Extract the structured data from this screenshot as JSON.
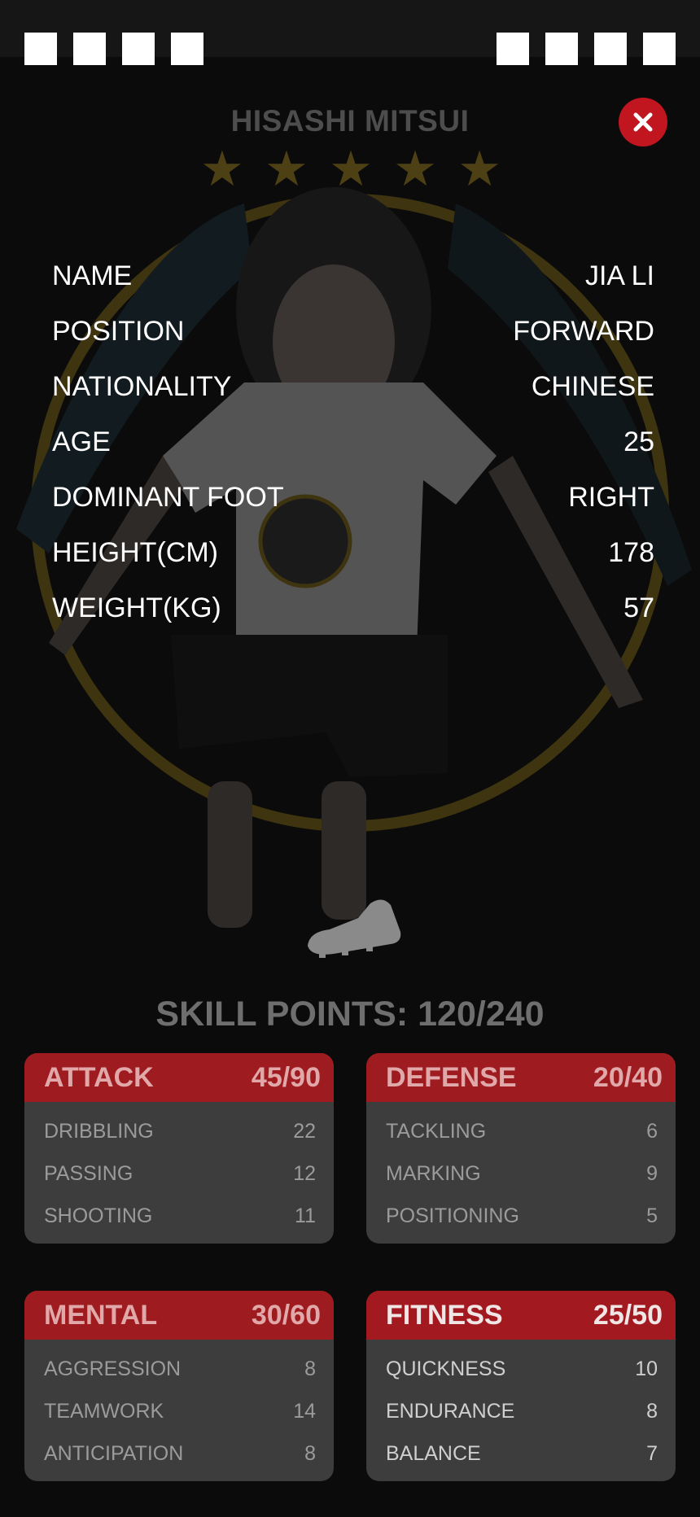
{
  "header": {
    "player_title": "HISASHI MITSUI",
    "star_rating": 5
  },
  "profile": [
    {
      "label": "NAME",
      "value": "JIA LI"
    },
    {
      "label": "POSITION",
      "value": "FORWARD"
    },
    {
      "label": "NATIONALITY",
      "value": "CHINESE"
    },
    {
      "label": "AGE",
      "value": "25"
    },
    {
      "label": "DOMINANT FOOT",
      "value": "RIGHT"
    },
    {
      "label": "HEIGHT(CM)",
      "value": "178"
    },
    {
      "label": "WEIGHT(KG)",
      "value": "57"
    }
  ],
  "skill_points": "SKILL POINTS: 120/240",
  "categories": [
    {
      "name": "ATTACK",
      "score": "45/90",
      "stats": [
        {
          "label": "DRIBBLING",
          "value": "22"
        },
        {
          "label": "PASSING",
          "value": "12"
        },
        {
          "label": "SHOOTING",
          "value": "11"
        }
      ]
    },
    {
      "name": "DEFENSE",
      "score": "20/40",
      "stats": [
        {
          "label": "TACKLING",
          "value": "6"
        },
        {
          "label": "MARKING",
          "value": "9"
        },
        {
          "label": "POSITIONING",
          "value": "5"
        }
      ]
    },
    {
      "name": "MENTAL",
      "score": "30/60",
      "stats": [
        {
          "label": "AGGRESSION",
          "value": "8"
        },
        {
          "label": "TEAMWORK",
          "value": "14"
        },
        {
          "label": "ANTICIPATION",
          "value": "8"
        }
      ]
    },
    {
      "name": "FITNESS",
      "score": "25/50",
      "stats": [
        {
          "label": "QUICKNESS",
          "value": "10"
        },
        {
          "label": "ENDURANCE",
          "value": "8"
        },
        {
          "label": "BALANCE",
          "value": "7"
        }
      ]
    }
  ],
  "colors": {
    "accent_red": "#c1161f",
    "card_header": "#9e1b20",
    "card_body": "#3d3d3d",
    "star": "#4d4014",
    "emblem_ring": "#3f3410"
  },
  "icons": {
    "close": "close-icon",
    "boot": "football-boot-icon",
    "star": "star-icon"
  }
}
